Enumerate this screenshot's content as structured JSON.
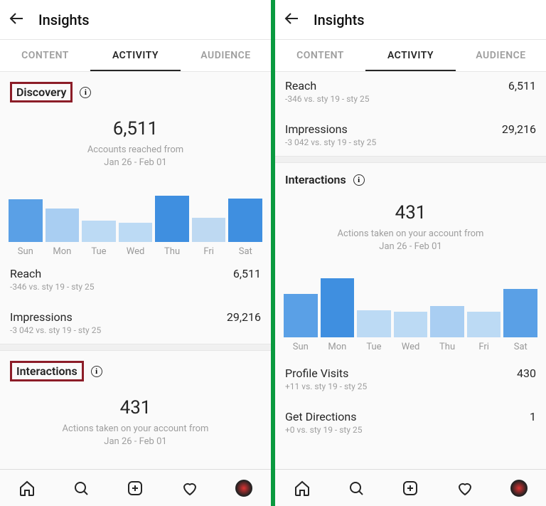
{
  "header": {
    "title": "Insights"
  },
  "tabs": {
    "content": "CONTENT",
    "activity": "ACTIVITY",
    "audience": "AUDIENCE"
  },
  "left": {
    "discovery": {
      "label": "Discovery",
      "value": "6,511",
      "desc1": "Accounts reached from",
      "desc2": "Jan 26 - Feb 01"
    },
    "reach": {
      "label": "Reach",
      "value": "6,511",
      "sub": "-346 vs. sty 19 - sty 25"
    },
    "impressions": {
      "label": "Impressions",
      "value": "29,216",
      "sub": "-3 042 vs. sty 19 - sty 25"
    },
    "interactions": {
      "label": "Interactions",
      "value": "431",
      "desc1": "Actions taken on your account from",
      "desc2": "Jan 26 - Feb 01"
    }
  },
  "right": {
    "reach": {
      "label": "Reach",
      "value": "6,511",
      "sub": "-346 vs. sty 19 - sty 25"
    },
    "impressions": {
      "label": "Impressions",
      "value": "29,216",
      "sub": "-3 042 vs. sty 19 - sty 25"
    },
    "interactions": {
      "label": "Interactions",
      "value": "431",
      "desc1": "Actions taken on your account from",
      "desc2": "Jan 26 - Feb 01"
    },
    "profile": {
      "label": "Profile Visits",
      "value": "430",
      "sub": "+11 vs. sty 19 - sty 25"
    },
    "directions": {
      "label": "Get Directions",
      "value": "1",
      "sub": "+0 vs. sty 19 - sty 25"
    }
  },
  "days": [
    "Sun",
    "Mon",
    "Tue",
    "Wed",
    "Thu",
    "Fri",
    "Sat"
  ],
  "chart_data": [
    {
      "type": "bar",
      "title": "Accounts reached from Jan 26 - Feb 01 (Discovery)",
      "xlabel": "",
      "ylabel": "",
      "categories": [
        "Sun",
        "Mon",
        "Tue",
        "Wed",
        "Thu",
        "Fri",
        "Sat"
      ],
      "values": [
        1200,
        950,
        600,
        550,
        1300,
        680,
        1231
      ],
      "colors": [
        "#5aa0e6",
        "#a9cef2",
        "#bcdaf4",
        "#bcdaf4",
        "#3f8fe0",
        "#bed9f2",
        "#3f8fe0"
      ],
      "ylim": [
        0,
        1400
      ]
    },
    {
      "type": "bar",
      "title": "Actions taken on your account from Jan 26 - Feb 01 (Interactions)",
      "xlabel": "",
      "ylabel": "",
      "categories": [
        "Sun",
        "Mon",
        "Tue",
        "Wed",
        "Thu",
        "Fri",
        "Sat"
      ],
      "values": [
        72,
        98,
        45,
        42,
        52,
        42,
        80
      ],
      "colors": [
        "#5aa0e6",
        "#3f8fe0",
        "#bcdaf4",
        "#bcdaf4",
        "#a9cef2",
        "#bcdaf4",
        "#5aa0e6"
      ],
      "ylim": [
        0,
        100
      ]
    }
  ]
}
